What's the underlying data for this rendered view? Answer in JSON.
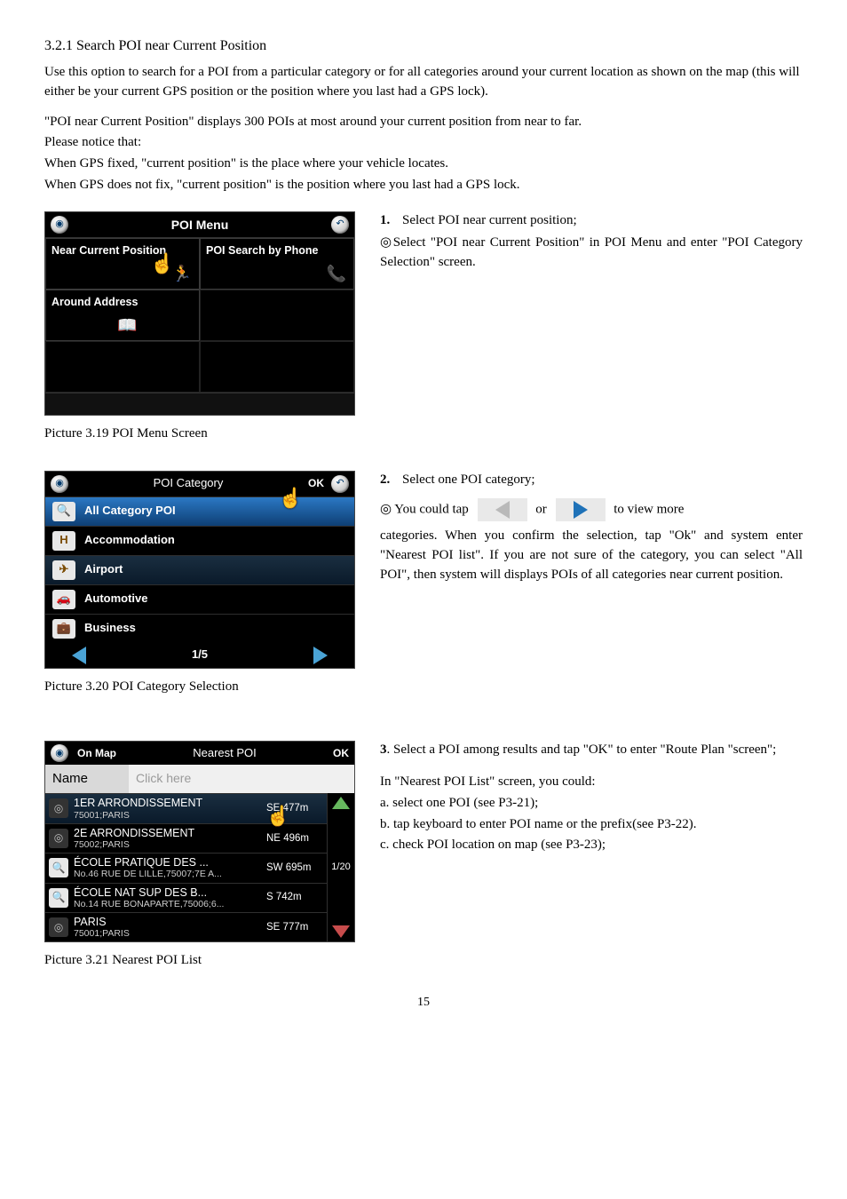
{
  "heading": "3.2.1 Search POI near Current Position",
  "para1": "Use this option to search for a POI from a particular category or for all categories around your current location as shown on the map (this will either be your current GPS position or the position where you last had a GPS lock).",
  "para2a": "\"POI near Current Position\" displays 300 POIs at most around your current position from near to far.",
  "para2b": "Please notice that:",
  "para2c": "When GPS fixed, \"current position\" is the place where your vehicle locates.",
  "para2d": "When GPS does not fix, \"current position\" is the position where you last had a GPS lock.",
  "step1": {
    "num": "1.",
    "text": "Select POI near current position;"
  },
  "step1b": "◎Select \"POI near Current Position\" in POI Menu and enter \"POI Category Selection\" screen.",
  "poiMenu": {
    "title": "POI Menu",
    "cells": [
      "Near Current Position",
      "POI Search by Phone",
      "Around Address"
    ]
  },
  "caption1": "Picture 3.19 POI Menu Screen",
  "step2": {
    "num": "2.",
    "text": "Select one POI category;"
  },
  "step2b_pre": "◎   You  could  tap",
  "step2b_mid": "or",
  "step2b_post": "to   view   more",
  "step2c": "categories. When you confirm the selection, tap \"Ok\" and system enter \"Nearest POI list\". If you are not sure of the category, you can select \"All POI\", then system will displays POIs of all categories near current position.",
  "poiCat": {
    "title": "POI Category",
    "ok": "OK",
    "items": [
      "All Category POI",
      "Accommodation",
      "Airport",
      "Automotive",
      "Business"
    ],
    "page": "1/5"
  },
  "caption2": "Picture 3.20 POI Category Selection",
  "step3a": "3",
  "step3b": ". Select a POI among results and tap \"OK\" to enter \"Route Plan \"screen\";",
  "step3_lines": {
    "intro": "In \"Nearest POI List\" screen, you could:",
    "a": "a. select one POI (see P3-21);",
    "b": "b. tap keyboard to enter POI name or the prefix(see P3-22).",
    "c": "c. check POI location on map (see P3-23);"
  },
  "nearest": {
    "tab": "On Map",
    "title": "Nearest POI",
    "ok": "OK",
    "nameLabel": "Name",
    "namePlaceholder": "Click here",
    "page": "1/20",
    "items": [
      {
        "n1": "1ER ARRONDISSEMENT",
        "n2": "75001;PARIS",
        "dir": "SE",
        "dist": "477m"
      },
      {
        "n1": "2E ARRONDISSEMENT",
        "n2": "75002;PARIS",
        "dir": "NE",
        "dist": "496m"
      },
      {
        "n1": "ÉCOLE PRATIQUE DES ...",
        "n2": "No.46 RUE DE LILLE,75007;7E A...",
        "dir": "SW",
        "dist": "695m"
      },
      {
        "n1": "ÉCOLE NAT SUP DES B...",
        "n2": "No.14 RUE BONAPARTE,75006;6...",
        "dir": "S",
        "dist": "742m"
      },
      {
        "n1": "PARIS",
        "n2": "75001;PARIS",
        "dir": "SE",
        "dist": "777m"
      }
    ]
  },
  "caption3": "Picture 3.21 Nearest POI List",
  "pageNum": "15"
}
